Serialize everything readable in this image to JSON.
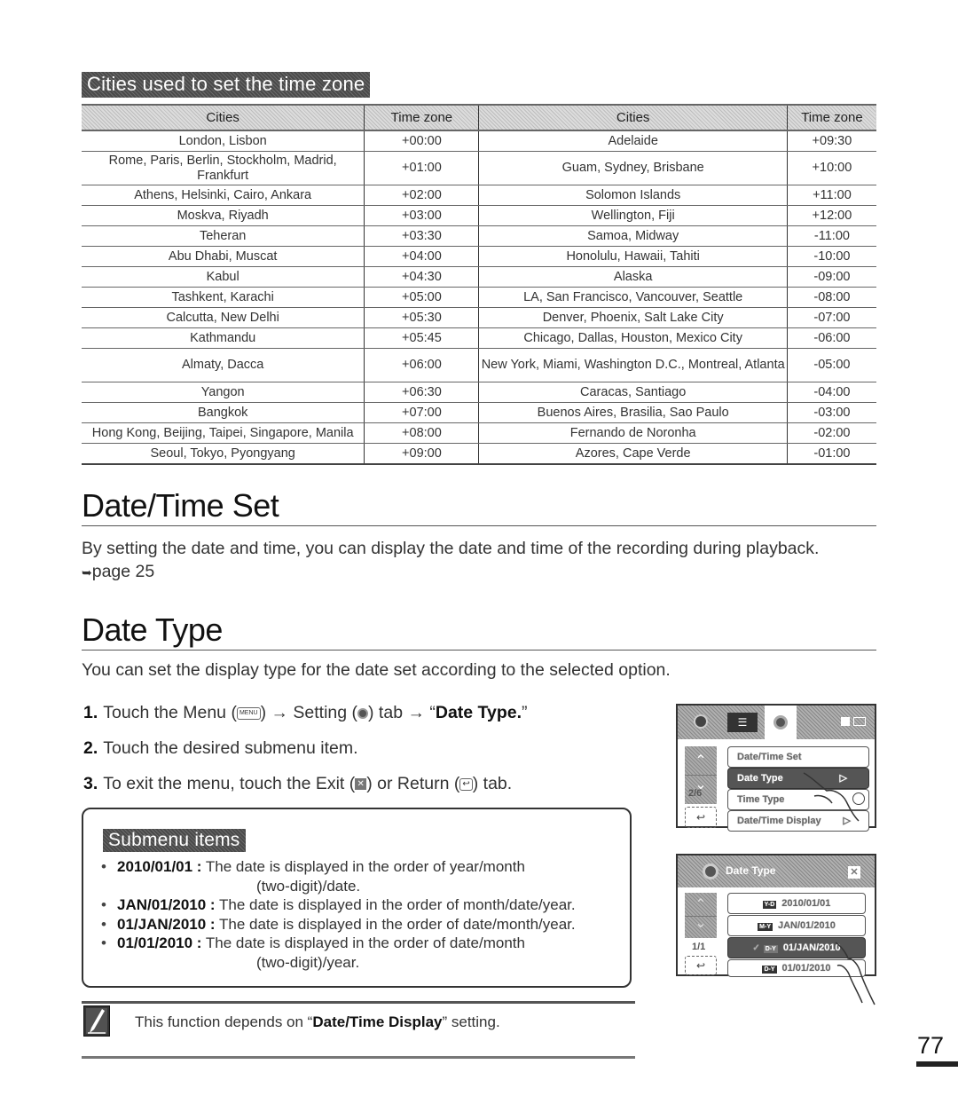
{
  "cities_section": {
    "title": "Cities used to set the time zone",
    "headers": {
      "cities": "Cities",
      "time_zone": "Time zone"
    },
    "left_rows": [
      {
        "cities": "London, Lisbon",
        "tz": "+00:00"
      },
      {
        "cities": "Rome, Paris, Berlin, Stockholm, Madrid, Frankfurt",
        "tz": "+01:00"
      },
      {
        "cities": "Athens, Helsinki, Cairo, Ankara",
        "tz": "+02:00"
      },
      {
        "cities": "Moskva, Riyadh",
        "tz": "+03:00"
      },
      {
        "cities": "Teheran",
        "tz": "+03:30"
      },
      {
        "cities": "Abu Dhabi, Muscat",
        "tz": "+04:00"
      },
      {
        "cities": "Kabul",
        "tz": "+04:30"
      },
      {
        "cities": "Tashkent, Karachi",
        "tz": "+05:00"
      },
      {
        "cities": "Calcutta, New Delhi",
        "tz": "+05:30"
      },
      {
        "cities": "Kathmandu",
        "tz": "+05:45"
      },
      {
        "cities": "Almaty, Dacca",
        "tz": "+06:00"
      },
      {
        "cities": "Yangon",
        "tz": "+06:30"
      },
      {
        "cities": "Bangkok",
        "tz": "+07:00"
      },
      {
        "cities": "Hong Kong, Beijing, Taipei, Singapore, Manila",
        "tz": "+08:00"
      },
      {
        "cities": "Seoul, Tokyo, Pyongyang",
        "tz": "+09:00"
      }
    ],
    "right_rows": [
      {
        "cities": "Adelaide",
        "tz": "+09:30"
      },
      {
        "cities": "Guam, Sydney, Brisbane",
        "tz": "+10:00"
      },
      {
        "cities": "Solomon Islands",
        "tz": "+11:00"
      },
      {
        "cities": "Wellington, Fiji",
        "tz": "+12:00"
      },
      {
        "cities": "Samoa, Midway",
        "tz": "-11:00"
      },
      {
        "cities": "Honolulu, Hawaii, Tahiti",
        "tz": "-10:00"
      },
      {
        "cities": "Alaska",
        "tz": "-09:00"
      },
      {
        "cities": "LA, San Francisco, Vancouver, Seattle",
        "tz": "-08:00"
      },
      {
        "cities": "Denver, Phoenix, Salt Lake City",
        "tz": "-07:00"
      },
      {
        "cities": "Chicago, Dallas, Houston, Mexico City",
        "tz": "-06:00"
      },
      {
        "cities": "New York, Miami, Washington D.C., Montreal, Atlanta",
        "tz": "-05:00"
      },
      {
        "cities": "Caracas, Santiago",
        "tz": "-04:00"
      },
      {
        "cities": "Buenos Aires, Brasilia, Sao Paulo",
        "tz": "-03:00"
      },
      {
        "cities": "Fernando de Noronha",
        "tz": "-02:00"
      },
      {
        "cities": "Azores, Cape Verde",
        "tz": "-01:00"
      }
    ]
  },
  "datetime_set": {
    "title": "Date/Time Set",
    "body": "By setting the date and time, you can display the date and time of the recording during playback.",
    "page_ref_arrow": "➥",
    "page_ref": "page 25"
  },
  "date_type": {
    "title": "Date Type",
    "intro": "You can set the display type for the date set according to the selected option.",
    "steps": [
      {
        "num": "1.",
        "pre": "Touch the Menu (",
        "menu_icon": "MENU",
        "mid1": ") → Setting (",
        "mid2": ") tab → “",
        "bold": "Date Type.",
        "post": "”"
      },
      {
        "num": "2.",
        "text": "Touch the desired submenu item."
      },
      {
        "num": "3.",
        "pre": "To exit the menu, touch the Exit (",
        "exit_icon": "✕",
        "mid": ") or Return (",
        "return_icon": "↩",
        "post": ") tab."
      }
    ]
  },
  "submenu": {
    "title": "Submenu items",
    "items": [
      {
        "key": "2010/01/01 :",
        "desc": "The date is displayed in the order of year/month",
        "cont": "(two-digit)/date."
      },
      {
        "key": "JAN/01/2010 :",
        "desc": "The date is displayed in the order of month/date/year.",
        "cont": ""
      },
      {
        "key": "01/JAN/2010 :",
        "desc": "The date is displayed in the order of date/month/year.",
        "cont": ""
      },
      {
        "key": "01/01/2010 :",
        "desc": "The date is displayed in the order of date/month",
        "cont": "(two-digit)/year."
      }
    ]
  },
  "note": {
    "pre": "This function depends on “",
    "bold": "Date/Time Display",
    "post": "” setting."
  },
  "page_number": "77",
  "screen1": {
    "rows": [
      "Date/Time Set",
      "Date Type",
      "Time Type",
      "Date/Time Display"
    ],
    "selected": "Date Type",
    "page": "2/6",
    "up": "⌃",
    "down": "⌄",
    "back": "↩",
    "play": "▷"
  },
  "screen2": {
    "title": "Date Type",
    "rows": [
      "2010/01/01",
      "JAN/01/2010",
      "01/JAN/2010",
      "01/01/2010"
    ],
    "row_badges": [
      "Y-D",
      "M-Y",
      "D-Y",
      "D-Y"
    ],
    "selected": "01/JAN/2010",
    "check": "✓",
    "page": "1/1",
    "close": "✕",
    "back": "↩"
  }
}
